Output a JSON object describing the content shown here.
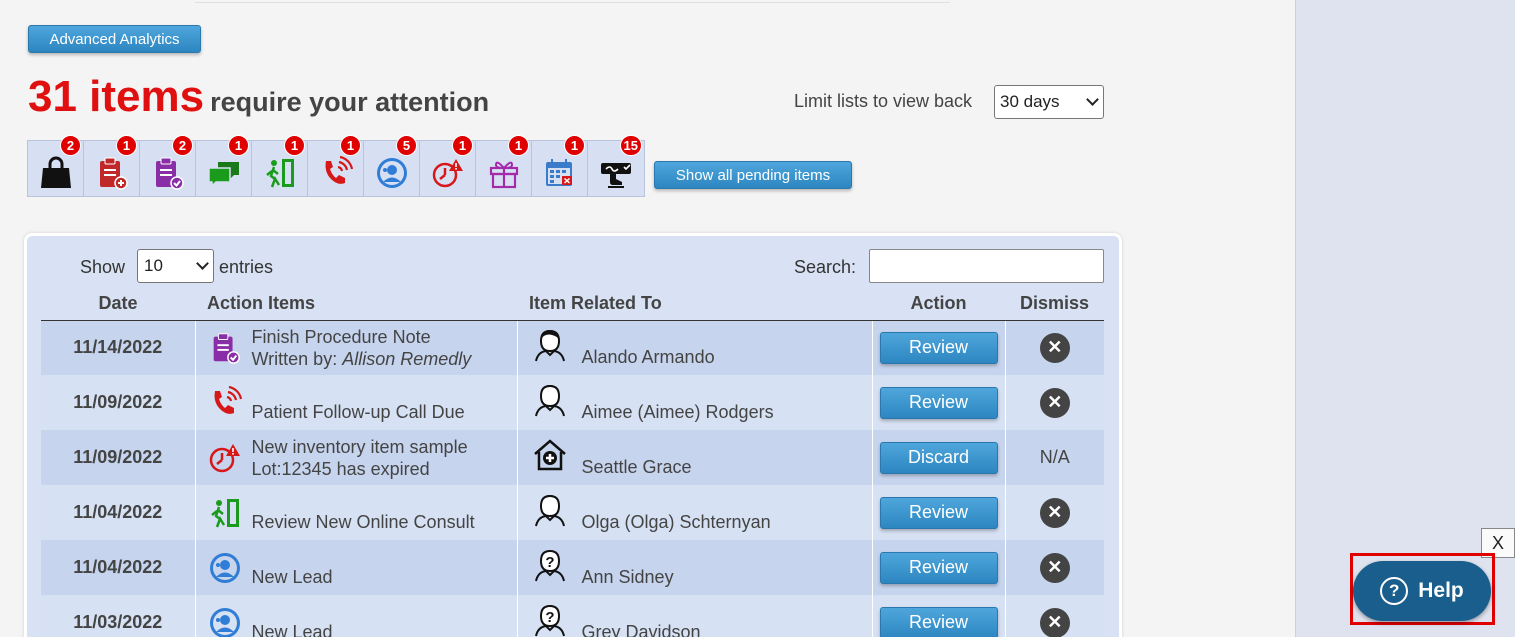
{
  "header": {
    "advanced_analytics_label": "Advanced Analytics",
    "items_count": "31 items",
    "items_text": "require your attention",
    "limit_label": "Limit lists to view back",
    "limit_value": "30 days",
    "show_all_label": "Show all pending items"
  },
  "iconbar": [
    {
      "icon": "shopping-bag-icon",
      "badge": "2"
    },
    {
      "icon": "clipboard-add-icon",
      "badge": "1"
    },
    {
      "icon": "clipboard-check-icon",
      "badge": "2"
    },
    {
      "icon": "chat-icon",
      "badge": "1"
    },
    {
      "icon": "exit-door-icon",
      "badge": "1"
    },
    {
      "icon": "phone-call-icon",
      "badge": "1"
    },
    {
      "icon": "lead-icon",
      "badge": "5"
    },
    {
      "icon": "expired-timer-icon",
      "badge": "1"
    },
    {
      "icon": "gift-icon",
      "badge": "1"
    },
    {
      "icon": "calendar-cancel-icon",
      "badge": "1"
    },
    {
      "icon": "signature-icon",
      "badge": "15"
    }
  ],
  "table_controls": {
    "show_label": "Show",
    "entries_value": "10",
    "entries_label": "entries",
    "search_label": "Search:"
  },
  "table": {
    "headers": [
      "Date",
      "Action Items",
      "Item Related To",
      "Action",
      "Dismiss"
    ],
    "rows": [
      {
        "date": "11/14/2022",
        "action_line1": "Finish Procedure Note",
        "action_line2_prefix": "Written by: ",
        "action_line2_author": "Allison Remedly",
        "action_icon": "clipboard-check-icon",
        "related": "Alando Armando",
        "related_icon": "person-icon",
        "action": "Review",
        "dismiss": "x"
      },
      {
        "date": "11/09/2022",
        "action_line1": "",
        "action_line2_prefix": "Patient Follow-up Call Due",
        "action_line2_author": "",
        "action_icon": "phone-call-icon",
        "related": "Aimee (Aimee) Rodgers",
        "related_icon": "person-icon",
        "action": "Review",
        "dismiss": "x"
      },
      {
        "date": "11/09/2022",
        "action_line1": "New inventory item sample",
        "action_line2_prefix": "Lot:12345 has expired",
        "action_line2_author": "",
        "action_icon": "expired-timer-icon",
        "related": "Seattle Grace",
        "related_icon": "clinic-icon",
        "action": "Discard",
        "dismiss": "N/A"
      },
      {
        "date": "11/04/2022",
        "action_line1": "",
        "action_line2_prefix": "Review New Online Consult",
        "action_line2_author": "",
        "action_icon": "exit-door-icon",
        "related": "Olga (Olga) Schternyan",
        "related_icon": "person-icon",
        "action": "Review",
        "dismiss": "x"
      },
      {
        "date": "11/04/2022",
        "action_line1": "",
        "action_line2_prefix": "New Lead",
        "action_line2_author": "",
        "action_icon": "lead-icon",
        "related": "Ann Sidney",
        "related_icon": "unknown-person-icon",
        "action": "Review",
        "dismiss": "x"
      },
      {
        "date": "11/03/2022",
        "action_line1": "",
        "action_line2_prefix": "New Lead",
        "action_line2_author": "",
        "action_icon": "lead-icon",
        "related": "Grey Davidson",
        "related_icon": "unknown-person-icon",
        "action": "Review",
        "dismiss": "x"
      }
    ]
  },
  "help": {
    "close_label": "X",
    "help_label": "Help",
    "help_q": "?"
  }
}
